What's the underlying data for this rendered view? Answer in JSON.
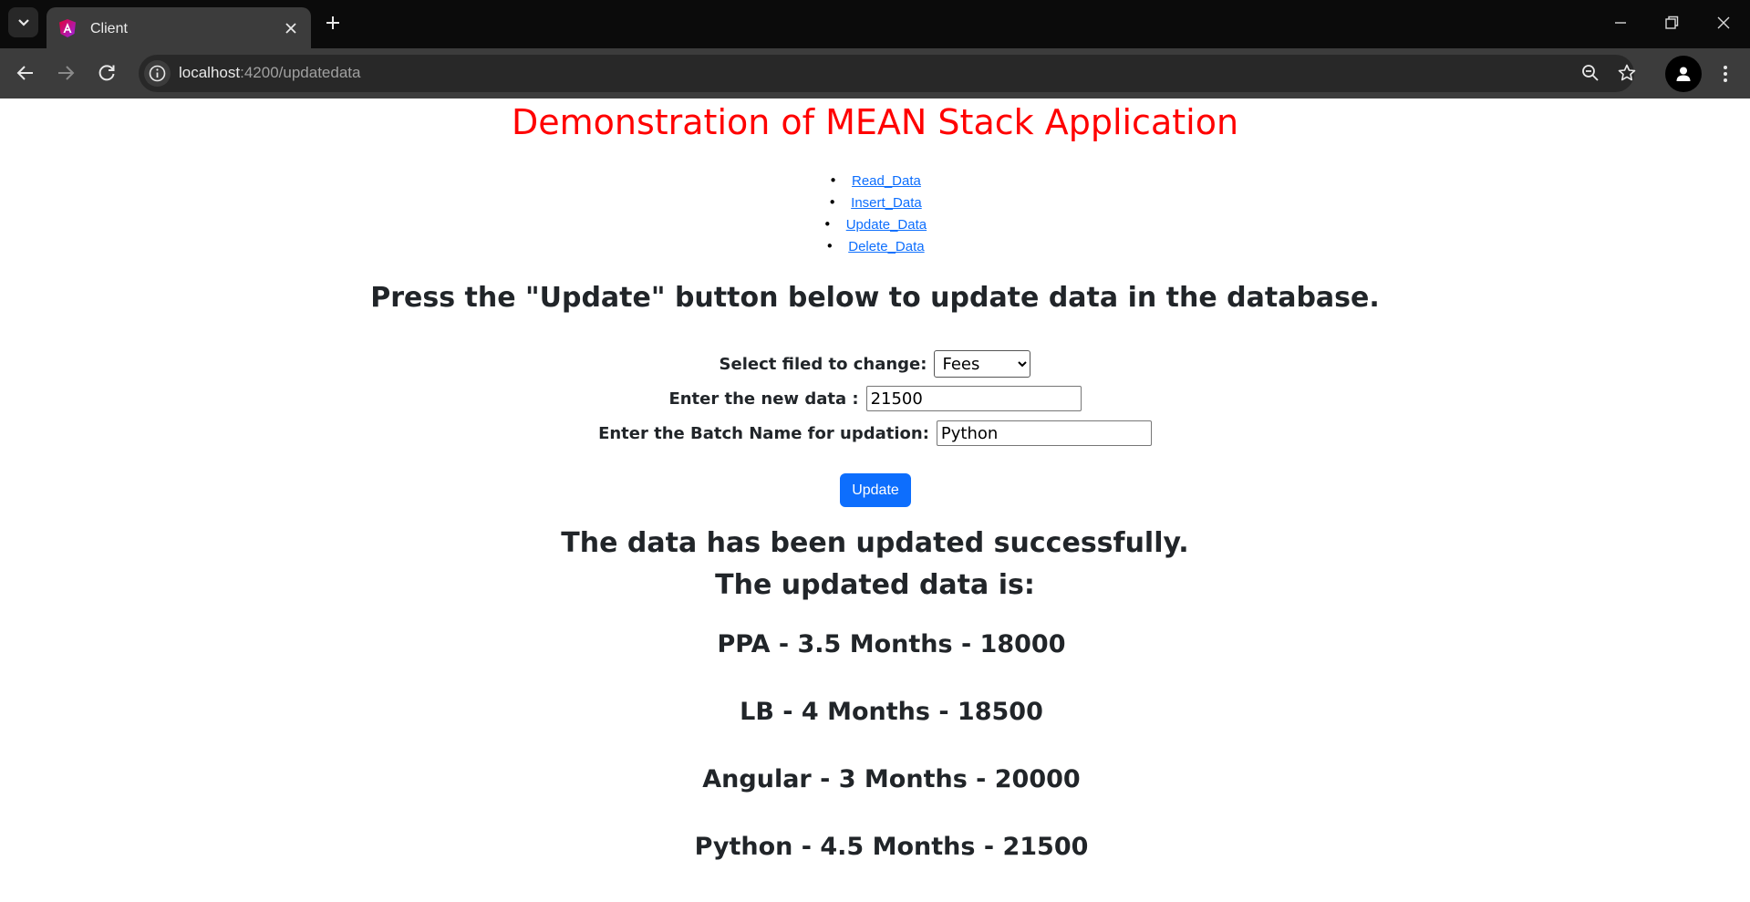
{
  "browser": {
    "tab_title": "Client",
    "url_host": "localhost",
    "url_path": ":4200/updatedata"
  },
  "page": {
    "title": "Demonstration of MEAN Stack Application",
    "nav": [
      {
        "label": "Read_Data"
      },
      {
        "label": "Insert_Data"
      },
      {
        "label": "Update_Data"
      },
      {
        "label": "Delete_Data"
      }
    ],
    "instruction": "Press the \"Update\" button below to update data in the database.",
    "form": {
      "field_label": "Select filed to change:",
      "field_selected": "Fees",
      "new_data_label": "Enter the new data :",
      "new_data_value": "21500",
      "batch_label": "Enter the Batch Name for updation:",
      "batch_value": "Python"
    },
    "update_button": "Update",
    "success_message": "The data has been updated successfully.",
    "updated_label": "The updated data is:",
    "records": [
      "PPA - 3.5 Months - 18000",
      "LB - 4 Months - 18500",
      "Angular - 3 Months - 20000",
      "Python - 4.5 Months - 21500"
    ]
  },
  "colors": {
    "title": "#ff0000",
    "link": "#0d6efd",
    "button": "#0d6efd"
  }
}
